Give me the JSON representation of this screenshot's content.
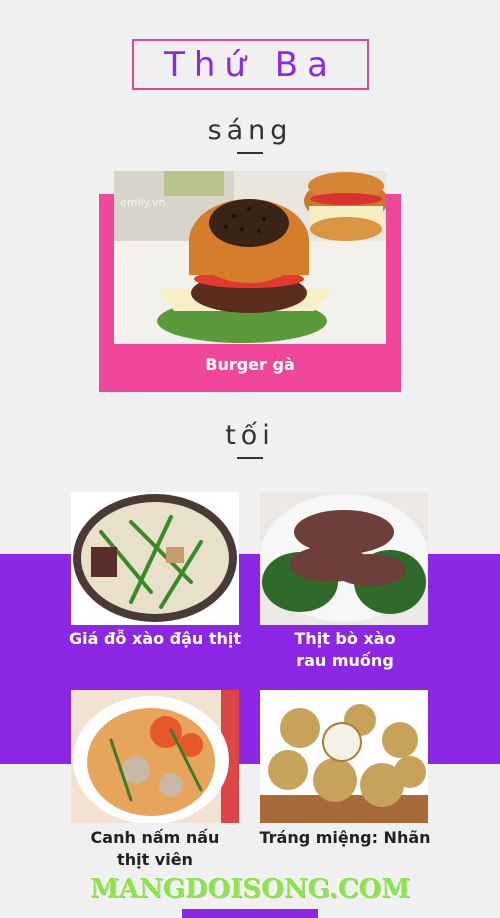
{
  "title": "Thứ Ba",
  "morning": {
    "label": "sáng",
    "dish": "Burger gà",
    "photo_watermark": "emily.vn"
  },
  "evening": {
    "label": "tối",
    "dishes": [
      {
        "name": "Giá đỗ xào đậu thịt"
      },
      {
        "name_line1": "Thịt bò xào",
        "name_line2": "rau muống"
      },
      {
        "name_line1": "Canh nấm nấu",
        "name_line2": "thịt viên"
      },
      {
        "name": "Tráng miệng: Nhãn"
      }
    ]
  },
  "watermark": "MANGDOISONG.COM",
  "colors": {
    "pink": "#f0479a",
    "purple": "#8c27e4",
    "title_text": "#8a2be2",
    "watermark": "#8ee34a"
  }
}
